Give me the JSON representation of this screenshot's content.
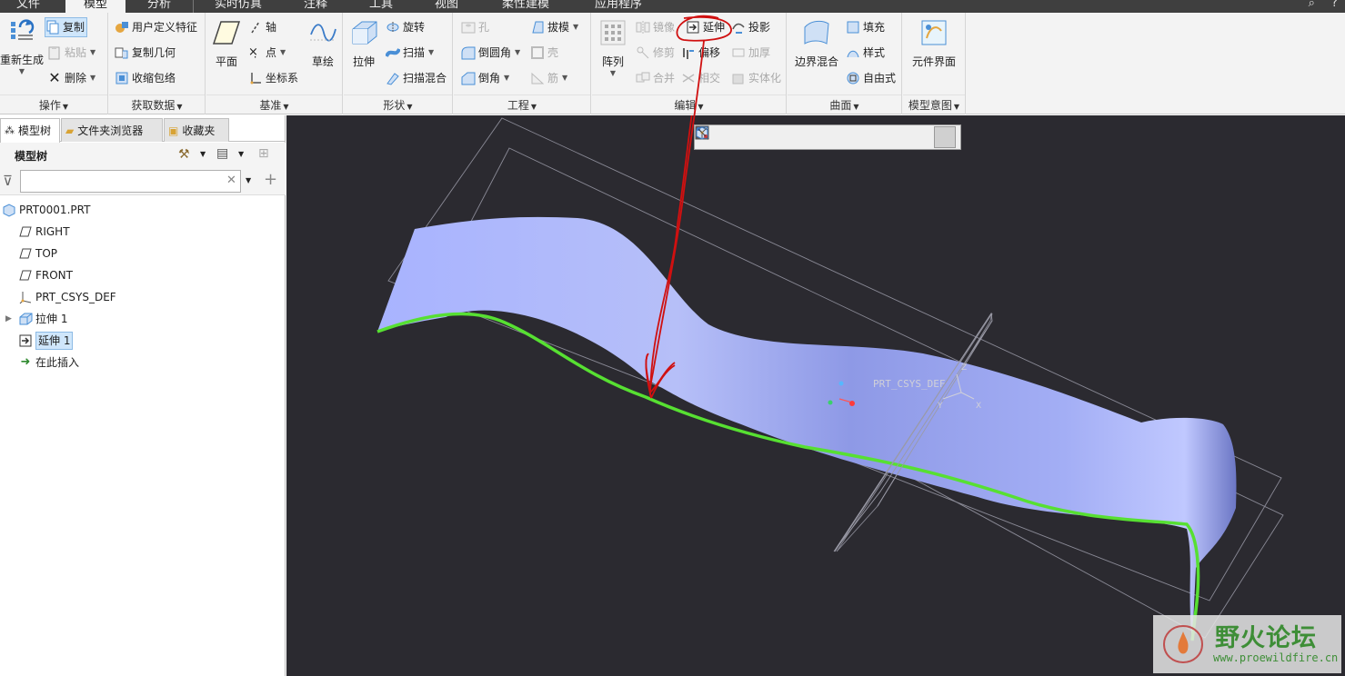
{
  "tabs": [
    "文件",
    "模型",
    "分析",
    "实时仿真",
    "注释",
    "工具",
    "视图",
    "柔性建模",
    "应用程序"
  ],
  "active_tab": "模型",
  "ribbon": {
    "operations": {
      "label": "操作",
      "regenerate": "重新生成",
      "copy": "复制",
      "paste": "粘贴",
      "delete": "删除"
    },
    "get_data": {
      "label": "获取数据",
      "udf": "用户定义特征",
      "copy_geom": "复制几何",
      "shrinkwrap": "收缩包络"
    },
    "datum": {
      "label": "基准",
      "plane": "平面",
      "axis": "轴",
      "point": "点",
      "csys": "坐标系",
      "sketch": "草绘"
    },
    "shapes": {
      "label": "形状",
      "extrude": "拉伸",
      "revolve": "旋转",
      "sweep": "扫描",
      "swept_blend": "扫描混合"
    },
    "engineering": {
      "label": "工程",
      "hole": "孔",
      "round": "倒圆角",
      "chamfer": "倒角",
      "draft": "拔模",
      "shell": "壳",
      "rib": "筋"
    },
    "editing": {
      "label": "编辑",
      "pattern": "阵列",
      "mirror": "镜像",
      "extend": "延伸",
      "project": "投影",
      "trim": "修剪",
      "offset": "偏移",
      "thicken": "加厚",
      "merge": "合并",
      "intersect": "相交",
      "solidify": "实体化"
    },
    "surfaces": {
      "label": "曲面",
      "boundary_blend": "边界混合",
      "fill": "填充",
      "style": "样式",
      "freestyle": "自由式"
    },
    "model_intent": {
      "label": "模型意图",
      "component_interface": "元件界面"
    }
  },
  "nav": {
    "tabs": [
      "模型树",
      "文件夹浏览器",
      "收藏夹"
    ],
    "tree_title": "模型树",
    "search_value": "",
    "tree": [
      {
        "label": "PRT0001.PRT",
        "icon": "part-icon"
      },
      {
        "label": "RIGHT",
        "icon": "datum-plane-icon"
      },
      {
        "label": "TOP",
        "icon": "datum-plane-icon"
      },
      {
        "label": "FRONT",
        "icon": "datum-plane-icon"
      },
      {
        "label": "PRT_CSYS_DEF",
        "icon": "csys-icon"
      },
      {
        "label": "拉伸 1",
        "icon": "extrude-icon"
      },
      {
        "label": "延伸 1",
        "icon": "extend-icon",
        "selected": true
      },
      {
        "label": "在此插入",
        "icon": "insert-arrow-icon"
      }
    ]
  },
  "viewport": {
    "csys_label": "PRT_CSYS_DEF",
    "axis_x": "X",
    "axis_y": "Y",
    "axis_z": "Z",
    "surface_color": "#9aa6f0",
    "edge_color": "#57e032",
    "annotation_color": "#d01010"
  },
  "watermark": {
    "title": "野火论坛",
    "url": "www.proewildfire.cn"
  }
}
